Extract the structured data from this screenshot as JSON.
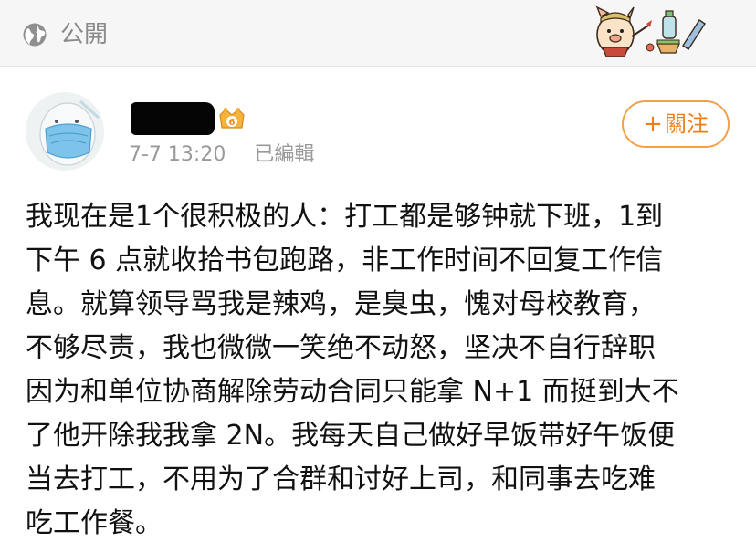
{
  "header": {
    "visibility_label": "公開",
    "icons": {
      "visibility": "globe-icon",
      "sticker": "character-sticker"
    }
  },
  "post": {
    "author": {
      "name_redacted": true,
      "badge": "vip-crown-badge"
    },
    "timestamp": "7-7 13:20",
    "edited_label": "已編輯",
    "follow_button": {
      "plus": "+",
      "label": "關注"
    },
    "body_lines": [
      "我现在是1个很积极的人：打工都是够钟就下班，1到",
      "下午 6 点就收拾书包跑路，非工作时间不回复工作信",
      "息。就算领导骂我是辣鸡，是臭虫，愧对母校教育，",
      "不够尽责，我也微微一笑绝不动怒，坚决不自行辞职",
      "因为和单位协商解除劳动合同只能拿 N+1 而挺到大不",
      "了他开除我我拿 2N。我每天自己做好早饭带好午饭便",
      "当去打工，不用为了合群和讨好上司，和同事去吃难",
      "吃工作餐。"
    ]
  },
  "colors": {
    "accent": "#ee7f17",
    "accent_border": "#f3a04a",
    "meta_text": "#9a9a9a",
    "body_text": "#111111",
    "header_bg": "#f6f6f6"
  }
}
